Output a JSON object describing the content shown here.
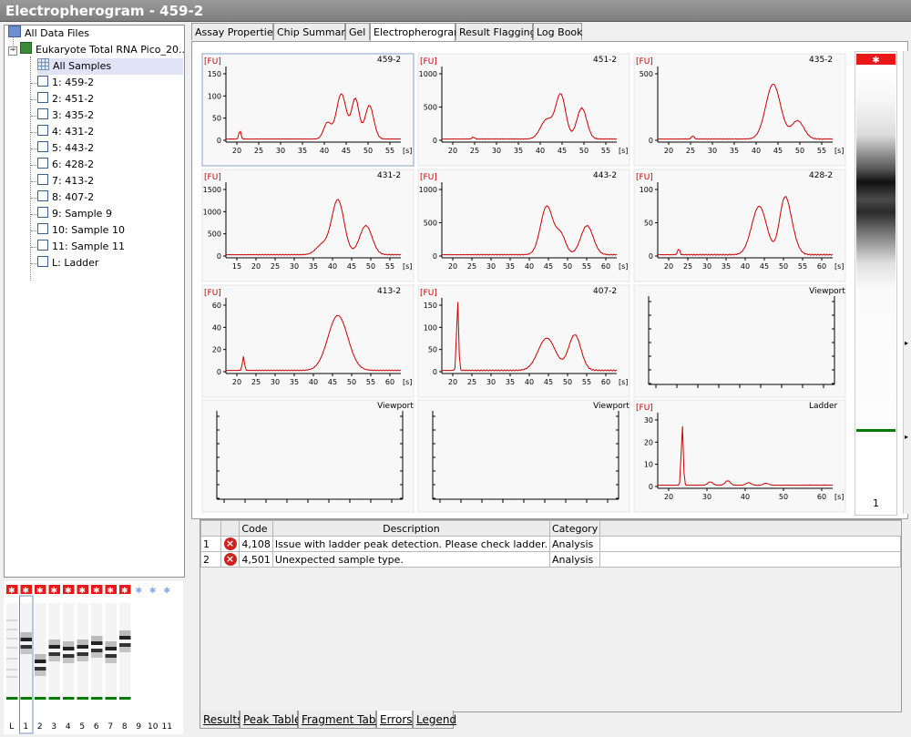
{
  "window": {
    "title": "Electropherogram - 459-2"
  },
  "tree": {
    "root": "All Data Files",
    "file": "Eukaryote Total RNA Pico_20...",
    "all_samples": "All Samples",
    "samples": [
      "1: 459-2",
      "2: 451-2",
      "3: 435-2",
      "4: 431-2",
      "5: 443-2",
      "6: 428-2",
      "7: 413-2",
      "8: 407-2",
      "9: Sample 9",
      "10: Sample 10",
      "11: Sample 11",
      "L: Ladder"
    ]
  },
  "tabs": [
    "Assay Properties",
    "Chip Summary",
    "Gel",
    "Electropherogram",
    "Result Flagging",
    "Log Book"
  ],
  "active_tab": "Electropherogram",
  "panels": [
    {
      "name": "459-2",
      "fu": "[FU]",
      "unit": "[s]",
      "yticks": [
        "150",
        "100",
        "50",
        "0"
      ],
      "xticks": [
        "20",
        "25",
        "30",
        "35",
        "40",
        "45",
        "50",
        "55"
      ]
    },
    {
      "name": "451-2",
      "fu": "[FU]",
      "unit": "[s]",
      "yticks": [
        "1000",
        "500",
        "0"
      ],
      "xticks": [
        "20",
        "25",
        "30",
        "35",
        "40",
        "45",
        "50",
        "55"
      ]
    },
    {
      "name": "435-2",
      "fu": "[FU]",
      "unit": "[s]",
      "yticks": [
        "500",
        "0"
      ],
      "xticks": [
        "20",
        "25",
        "30",
        "35",
        "40",
        "45",
        "50",
        "55"
      ]
    },
    {
      "name": "431-2",
      "fu": "[FU]",
      "unit": "[s]",
      "yticks": [
        "1500",
        "1000",
        "500",
        "0"
      ],
      "xticks": [
        "15",
        "20",
        "25",
        "30",
        "35",
        "40",
        "45",
        "50",
        "55"
      ]
    },
    {
      "name": "443-2",
      "fu": "[FU]",
      "unit": "[s]",
      "yticks": [
        "1000",
        "500",
        "0"
      ],
      "xticks": [
        "20",
        "25",
        "30",
        "35",
        "40",
        "45",
        "50",
        "55",
        "60"
      ]
    },
    {
      "name": "428-2",
      "fu": "[FU]",
      "unit": "[s]",
      "yticks": [
        "100",
        "50",
        "0"
      ],
      "xticks": [
        "20",
        "25",
        "30",
        "35",
        "40",
        "45",
        "50",
        "55",
        "60"
      ]
    },
    {
      "name": "413-2",
      "fu": "[FU]",
      "unit": "[s]",
      "yticks": [
        "60",
        "40",
        "20",
        "0"
      ],
      "xticks": [
        "20",
        "25",
        "30",
        "35",
        "40",
        "45",
        "50",
        "55",
        "60"
      ]
    },
    {
      "name": "407-2",
      "fu": "[FU]",
      "unit": "[s]",
      "yticks": [
        "150",
        "100",
        "50",
        "0"
      ],
      "xticks": [
        "20",
        "25",
        "30",
        "35",
        "40",
        "45",
        "50",
        "55",
        "60"
      ]
    },
    {
      "name": "Viewport",
      "fu": "",
      "unit": "",
      "yticks": [],
      "xticks": []
    },
    {
      "name": "Viewport",
      "fu": "",
      "unit": "",
      "yticks": [],
      "xticks": []
    },
    {
      "name": "Viewport",
      "fu": "",
      "unit": "",
      "yticks": [],
      "xticks": []
    },
    {
      "name": "Ladder",
      "fu": "[FU]",
      "unit": "[s]",
      "yticks": [
        "30",
        "20",
        "10",
        "0"
      ],
      "xticks": [
        "20",
        "30",
        "40",
        "50",
        "60"
      ]
    }
  ],
  "gel_lane_label": "1",
  "minigel": {
    "lanes": [
      "L",
      "1",
      "2",
      "3",
      "4",
      "5",
      "6",
      "7",
      "8",
      "9",
      "10",
      "11"
    ]
  },
  "errors": {
    "columns": [
      "Code",
      "Description",
      "Category"
    ],
    "rows": [
      {
        "num": "1",
        "code": "4,108",
        "description": "Issue with ladder peak detection. Please check ladder.",
        "category": "Analysis"
      },
      {
        "num": "2",
        "code": "4,501",
        "description": "Unexpected sample type.",
        "category": "Analysis"
      }
    ]
  },
  "bottom_tabs": [
    "Results",
    "Peak Table",
    "Fragment Table",
    "Errors",
    "Legend"
  ],
  "active_bottom_tab": "Errors",
  "colors": {
    "trace": "#cc0000",
    "marker_line": "#007a00",
    "selected": "#dfe3f5"
  }
}
